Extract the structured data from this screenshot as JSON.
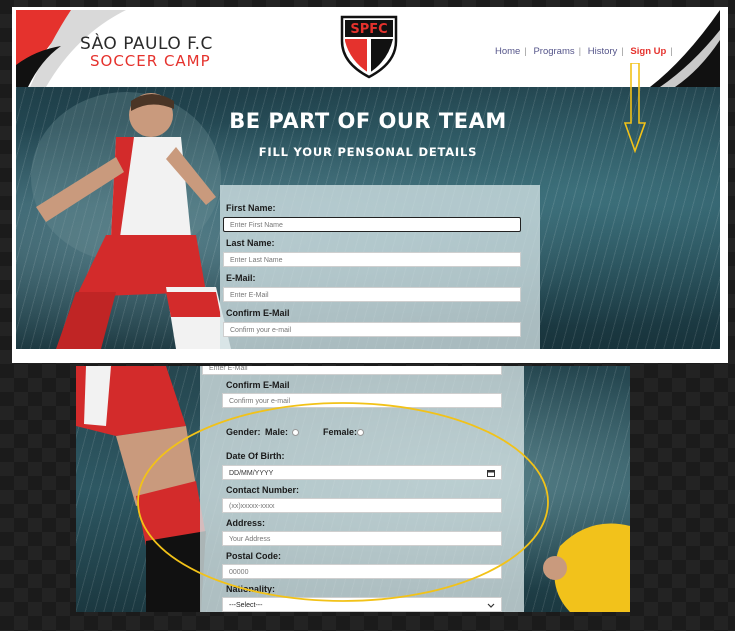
{
  "header": {
    "brand_title": "SÀO PAULO F.C",
    "brand_subtitle": "SOCCER CAMP",
    "crest_text": "SPFC",
    "nav": [
      "Home",
      "Programs",
      "History",
      "Sign Up"
    ]
  },
  "hero": {
    "title": "BE PART OF OUR TEAM",
    "subtitle": "FILL YOUR PENSONAL DETAILS"
  },
  "form_top": {
    "first_name_label": "First Name:",
    "first_name_placeholder": "Enter First Name",
    "last_name_label": "Last Name:",
    "last_name_placeholder": "Enter Last Name",
    "email_label": "E-Mail:",
    "email_placeholder": "Enter E-Mail",
    "confirm_email_label": "Confirm E-Mail",
    "confirm_email_placeholder": "Confirm your e-mail"
  },
  "form_bottom": {
    "email_placeholder_partial": "Enter E-Mail",
    "confirm_email_label": "Confirm E-Mail",
    "confirm_email_placeholder": "Confirm your e-mail",
    "gender_label": "Gender:",
    "male_label": "Male:",
    "female_label": "Female:",
    "dob_label": "Date Of Birth:",
    "dob_placeholder": "DD/MM/YYYY",
    "contact_label": "Contact Number:",
    "contact_placeholder": "(xx)xxxxx-xxxx",
    "address_label": "Address:",
    "address_placeholder": "Your Address",
    "postal_label": "Postal Code:",
    "postal_placeholder": "00000",
    "nationality_label": "Nationality:",
    "nationality_selected": "---Select---"
  },
  "colors": {
    "brand_red": "#e5322d",
    "annotation_yellow": "#f2c218",
    "nav_link": "#55558a"
  },
  "icons": [
    "calendar-icon",
    "chevron-down-icon",
    "down-arrow-annotation-icon"
  ]
}
